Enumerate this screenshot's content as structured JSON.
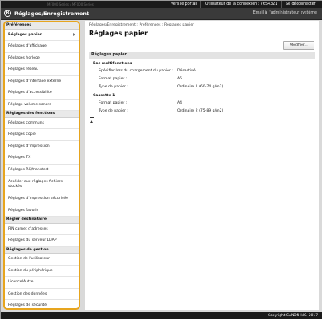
{
  "topbar": {
    "device_model": "MF000 Series / MF000 Series",
    "portal": "Vers le portail",
    "user_label": "Utilisateur de la connexion :",
    "user_id": "7654321",
    "logout": "Se déconnecter"
  },
  "header": {
    "logo_glyph": "R",
    "title": "Réglages/Enregistrement",
    "mail_admin": "Email à l'administrateur système"
  },
  "sidebar": {
    "sections": [
      {
        "title": "Préférences",
        "items": [
          "Réglages papier",
          "Réglages d'affichage",
          "Réglages horloge",
          "Réglages réseau",
          "Réglages d'interface externe",
          "Réglages d'accessibilité",
          "Réglage volume sonore"
        ]
      },
      {
        "title": "Réglages des fonctions",
        "items": [
          "Réglages communs",
          "Réglages copie",
          "Réglages d'impression",
          "Réglages TX",
          "Réglages RX/transfert",
          "Accéder aux réglages fichiers stockés",
          "Réglages d'impression sécurisée",
          "Réglages favoris"
        ]
      },
      {
        "title": "Régler destinataire",
        "items": [
          "PIN carnet d'adresses",
          "Réglages du serveur LDAP"
        ]
      },
      {
        "title": "Réglages de gestion",
        "items": [
          "Gestion de l'utilisateur",
          "Gestion du périphérique",
          "Licence/Autre",
          "Gestion des données",
          "Réglages de sécurité"
        ]
      }
    ]
  },
  "main": {
    "breadcrumb": [
      "Réglages/Enregistrement",
      "Préférences",
      "Réglages papier"
    ],
    "breadcrumb_sep": ":",
    "title": "Réglages papier",
    "modify_label": "Modifier...",
    "section_title": "Réglages papier",
    "groups": [
      {
        "name": "Bac multifonctions",
        "rows": [
          {
            "label": "Spécifier lors du chargement du papier :",
            "value": "Désactivé"
          },
          {
            "label": "Format papier :",
            "value": "A5"
          },
          {
            "label": "Type de papier :",
            "value": "Ordinaire 1 (60-74 g/m2)"
          }
        ]
      },
      {
        "name": "Cassette 1",
        "rows": [
          {
            "label": "Format papier :",
            "value": "A4"
          },
          {
            "label": "Type de papier :",
            "value": "Ordinaire 2 (75-89 g/m2)"
          }
        ]
      }
    ]
  },
  "footer": {
    "copyright": "Copyright CANON INC. 2017"
  }
}
